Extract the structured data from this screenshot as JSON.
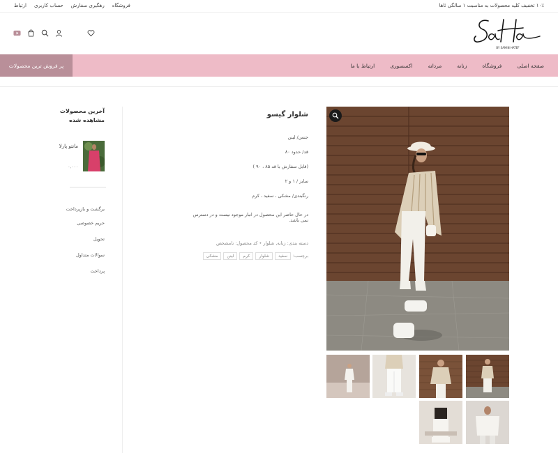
{
  "topbar": {
    "promo": "۱۰٪ تخفیف کلیه محصولات به مناسبت ۱ سالگی ثاها",
    "links": [
      "فروشگاه",
      "رهگیری سفارش",
      "حساب کاربری",
      "ارتباط"
    ]
  },
  "brand": {
    "logo_text": "SaHa",
    "logo_sub": "BY SAMIN HATEF"
  },
  "header_icons": [
    "heart-icon",
    "user-icon",
    "search-icon",
    "cart-icon",
    "youtube-icon"
  ],
  "nav": {
    "items": [
      "صفحه اصلی",
      "فروشگاه",
      "زنانه",
      "مردانه",
      "اکسسوری",
      "ارتباط با ما"
    ],
    "best_sellers": "پر فروش ترین محصولات",
    "accent_color": "#eebbc7",
    "best_sellers_color": "#b98f99"
  },
  "product": {
    "title": "شلوار گیسو",
    "details": [
      "جنس/ لینن",
      "قد/ حدود ۸۰",
      "(قابل سفارش با قد ۸۵ ، ۹۰ )",
      "سایز / ۱ و ۲",
      "رنگبندی/ مشکی ، سفید ، کرم"
    ],
    "stock_note": "در حال حاضر این محصول در انبار موجود نیست و در دسترس نمی باشد.",
    "meta_line": "دسته بندی: زنانه, شلوار  •  کد محصول: نامشخص",
    "tags_label": "برچسب:",
    "tags": [
      "سفید",
      "شلوار",
      "کرم",
      "لینن",
      "مشکی"
    ]
  },
  "sidebar": {
    "recent_title": "آخرین محصولات مشاهده شده",
    "recent_item": {
      "name": "مانتو پارلا",
      "price": "۰,۰۰۰"
    },
    "links": [
      "برگشت و بازپرداخت",
      "حریم خصوصی",
      "تحویل",
      "سوالات متداول",
      "پرداخت"
    ]
  }
}
